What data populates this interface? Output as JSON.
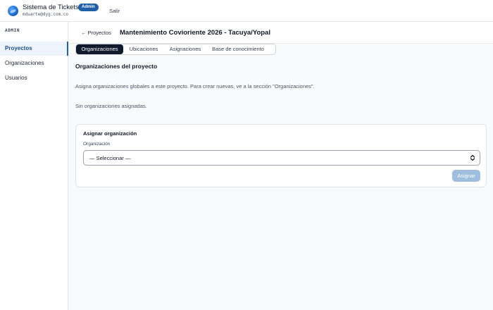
{
  "header": {
    "app_title": "Sistema de Tickets",
    "role_badge": "Admin",
    "user_email": "mduarte@dyg.com.co",
    "logout_label": "Salir"
  },
  "sidebar": {
    "section_label": "ADMIN",
    "items": [
      {
        "label": "Proyectos",
        "active": true
      },
      {
        "label": "Organizaciones",
        "active": false
      },
      {
        "label": "Usuarios",
        "active": false
      }
    ]
  },
  "page": {
    "back_label": "← Proyectos",
    "title": "Mantenimiento Covioriente 2026 - Tacuya/Yopal"
  },
  "tabs": [
    {
      "label": "Organizaciones",
      "active": true
    },
    {
      "label": "Ubicaciones",
      "active": false
    },
    {
      "label": "Asignaciones",
      "active": false
    },
    {
      "label": "Base de conocimiento",
      "active": false
    }
  ],
  "content": {
    "section_title": "Organizaciones del proyecto",
    "help_text": "Asigna organizaciones globales a este proyecto. Para crear nuevas, ve a la sección \"Organizaciones\".",
    "empty_text": "Sin organizaciones asignadas."
  },
  "assign_form": {
    "title": "Asignar organización",
    "field_label": "Organización",
    "select_value": "— Seleccionar —",
    "button_label": "Asignar",
    "button_disabled": true
  },
  "colors": {
    "brand": "#1e5fa8",
    "active_tab": "#0f1b2d",
    "disabled_button": "#9fbddd"
  }
}
